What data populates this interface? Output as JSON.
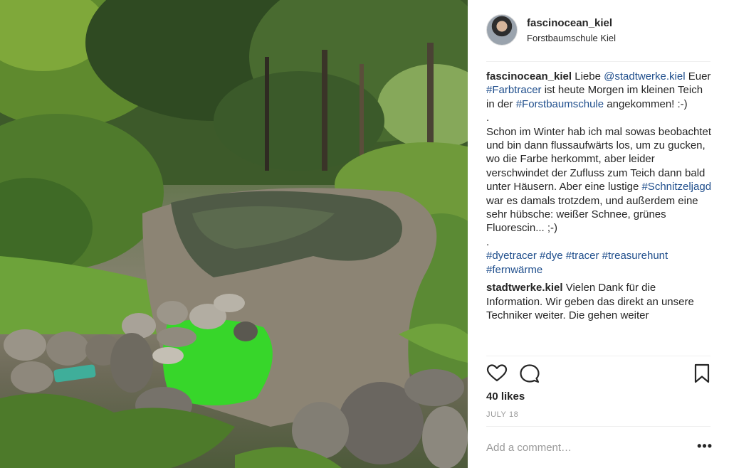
{
  "post": {
    "username": "fascinocean_kiel",
    "location": "Forstbaumschule Kiel",
    "likes": "40 likes",
    "date": "JULY 18",
    "comment_placeholder": "Add a comment…",
    "more_label": "•••"
  },
  "caption": {
    "user": "fascinocean_kiel",
    "t1": " Liebe ",
    "mention": "@stadtwerke.kiel",
    "t2": " Euer ",
    "tag_farbtracer": "#Farbtracer",
    "t3": " ist heute Morgen im kleinen Teich in der ",
    "tag_forstbaumschule": "#Forstbaumschule",
    "t4": " angekommen! :-)",
    "dot1": ".",
    "t5": "Schon im Winter hab ich mal sowas beobachtet und bin dann flussaufwärts los, um zu gucken, wo die Farbe herkommt, aber leider verschwindet der Zufluss zum Teich dann bald unter Häusern. Aber eine lustige ",
    "tag_schnitzeljagd": "#Schnitzeljagd",
    "t6": " war es damals trotzdem, und außerdem eine sehr hübsche: weißer Schnee, grünes Fluorescin... ;-)",
    "dot2": ".",
    "tag_dyetracer": "#dyetracer",
    "tag_dye": "#dye",
    "tag_tracer": "#tracer",
    "tag_treasurehunt": "#treasurehunt",
    "tag_fernwaerme": "#fernwärme"
  },
  "reply": {
    "user": "stadtwerke.kiel",
    "text": " Vielen Dank für die Information. Wir geben das direkt an unsere Techniker weiter. Die gehen weiter"
  },
  "icons": {
    "like": "heart-icon",
    "comment": "comment-icon",
    "save": "bookmark-icon"
  },
  "colors": {
    "link": "#1f4e8c",
    "text": "#262626",
    "muted": "#999999",
    "dye_green": "#37d62a"
  }
}
